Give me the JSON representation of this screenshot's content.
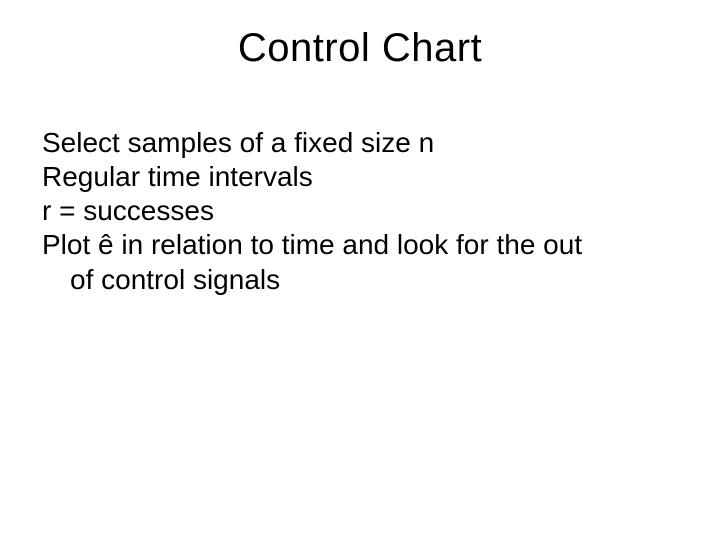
{
  "slide": {
    "title": "Control Chart",
    "lines": {
      "l1": "Select samples of a  fixed size n",
      "l2": "Regular time intervals",
      "l3": "r = successes",
      "l4a": "Plot ",
      "l4b": " in relation to time and look for the out",
      "l5": "of control signals",
      "symbol": "ê"
    }
  }
}
